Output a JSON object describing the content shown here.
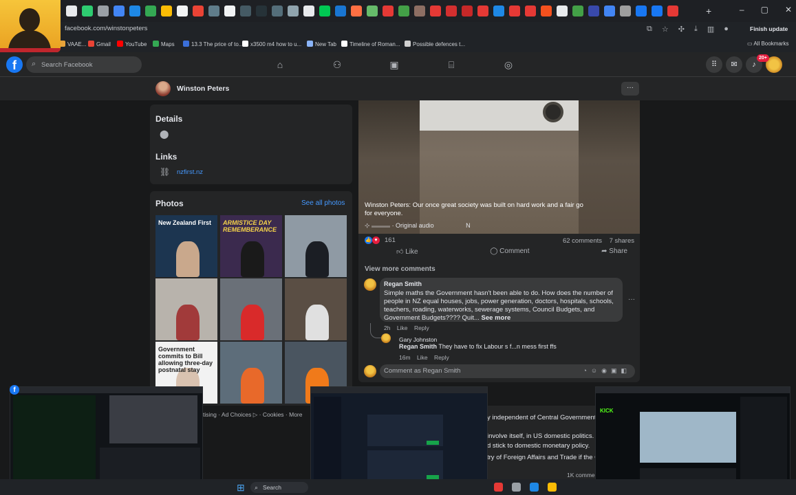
{
  "browser": {
    "url": "facebook.com/winstonpeters",
    "finish_update": "Finish update",
    "all_bookmarks": "All Bookmarks",
    "bookmarks": [
      {
        "label": "VAAE...",
        "color": "#e8a33a"
      },
      {
        "label": "Gmail",
        "color": "#ea4335"
      },
      {
        "label": "YouTube",
        "color": "#ff0000"
      },
      {
        "label": "Maps",
        "color": "#34a853"
      },
      {
        "label": "13.3 The price of to...",
        "color": "#3b6fd9"
      },
      {
        "label": "x3500 m4 how to u...",
        "color": "#ffffff"
      },
      {
        "label": "New Tab",
        "color": "#8ab4f8"
      },
      {
        "label": "Timeline of Roman...",
        "color": "#ffffff"
      },
      {
        "label": "Possible defences t...",
        "color": "#d0d0d0"
      }
    ],
    "tab_colors": [
      "#e8eaed",
      "#2ecc71",
      "#9aa0a6",
      "#4285f4",
      "#1e88e5",
      "#34a853",
      "#fbbc05",
      "#f1f3f4",
      "#ea4335",
      "#607d8b",
      "#f1f3f4",
      "#455a64",
      "#263238",
      "#546e7a",
      "#90a4ae",
      "#e8eaed",
      "#00c853",
      "#1976d2",
      "#ff7043",
      "#66bb6a",
      "#e53935",
      "#43a047",
      "#8d6e63",
      "#e53935",
      "#d32f2f",
      "#c62828",
      "#e53935",
      "#1e88e5",
      "#e53935",
      "#e53935",
      "#f4511e",
      "#e8eaed",
      "#43a047",
      "#3949ab",
      "#4285f4",
      "#9e9e9e",
      "#1877f2",
      "#1877f2",
      "#e53935"
    ]
  },
  "facebook": {
    "logo": "f",
    "search_placeholder": "Search Facebook",
    "notifications_count": "20+",
    "page_name": "Winston Peters",
    "page_more": "···",
    "details_title": "Details",
    "links_title": "Links",
    "link": "nzfirst.nz",
    "photos_title": "Photos",
    "see_all_photos": "See all photos",
    "photos": [
      {
        "caption": "New Zealand First",
        "bg": "#1c3550",
        "fig": "#c9a88c"
      },
      {
        "caption": "ARMISTICE DAY REMEMBERANCE",
        "bg": "#3b2a4e",
        "fig": "#1a1a1a"
      },
      {
        "caption": "",
        "bg": "#8f9aa4",
        "fig": "#1b1e24"
      },
      {
        "caption": "",
        "bg": "#b8b3ac",
        "fig": "#a13a3a"
      },
      {
        "caption": "",
        "bg": "#6a7078",
        "fig": "#d92a2a"
      },
      {
        "caption": "",
        "bg": "#5a4e44",
        "fig": "#e0e0e0"
      },
      {
        "caption": "Government commits to Bill allowing three-day postnatal stay",
        "bg": "#f2f2f2",
        "fig": "#d9c2b0"
      },
      {
        "caption": "",
        "bg": "#5d6d7a",
        "fig": "#e8692a"
      },
      {
        "caption": "",
        "bg": "#4a5560",
        "fig": "#f07a1a"
      }
    ],
    "post": {
      "caption": "Winston Peters: Our once great society was built on hard work and a fair go for everyone.",
      "audio": "· Original audio",
      "audio_right": "N",
      "reactions_count": "161",
      "comments_count": "62 comments",
      "shares_count": "7 shares",
      "like": "Like",
      "comment": "Comment",
      "share": "Share",
      "view_more_comments": "View more comments"
    },
    "comment1": {
      "author": "Regan Smith",
      "text": "Simple maths the Government hasn't been able to do. How does the number of people in NZ equal houses, jobs, power generation, doctors, hospitals, schools, teachers, roading, waterworks, sewerage systems, Council Budgets, and Government Budgets???? Quit...",
      "see_more": "See more",
      "time": "2h",
      "like": "Like",
      "reply": "Reply"
    },
    "reply1": {
      "author": "Gary Johnston",
      "mention": "Regan Smith",
      "text": "They have to fix Labour s f...n mess first ffs",
      "time": "16m",
      "like": "Like",
      "reply": "Reply"
    },
    "comment_placeholder": "Comment as Regan Smith",
    "footer_links": "tising · Ad Choices ▷ · Cookies · More",
    "post2_lines": [
      "y independent of Central Government of",
      "involve itself, in US domestic politics. W",
      "d stick to domestic monetary policy.",
      "try of Foreign Affairs and Trade if the G",
      "1K comme"
    ]
  },
  "taskbar": {
    "search": "Search"
  }
}
